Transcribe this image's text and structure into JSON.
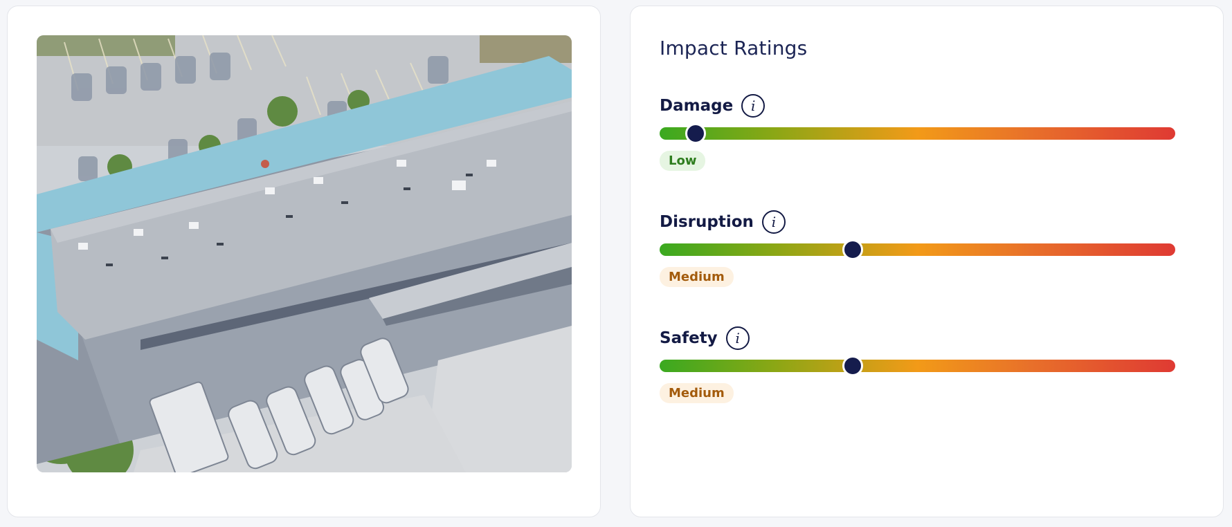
{
  "panel": {
    "title": "Impact Ratings"
  },
  "image": {
    "alt": "Aerial view of commercial building"
  },
  "ratings": [
    {
      "label": "Damage",
      "level": "Low",
      "position": 0.07,
      "badge_bg": "#e6f5e2",
      "badge_color": "#2e7d1e"
    },
    {
      "label": "Disruption",
      "level": "Medium",
      "position": 0.375,
      "badge_bg": "#fdf1e1",
      "badge_color": "#a35b0c"
    },
    {
      "label": "Safety",
      "level": "Medium",
      "position": 0.375,
      "badge_bg": "#fdf1e1",
      "badge_color": "#a35b0c"
    }
  ],
  "colors": {
    "gradient": [
      "#3aa920",
      "#8aa715",
      "#f29a18",
      "#e8702a",
      "#df3a33"
    ],
    "thumb": "#151c4d",
    "text": "#131a44"
  },
  "icons": {
    "info": "info-icon",
    "info_glyph": "i"
  }
}
